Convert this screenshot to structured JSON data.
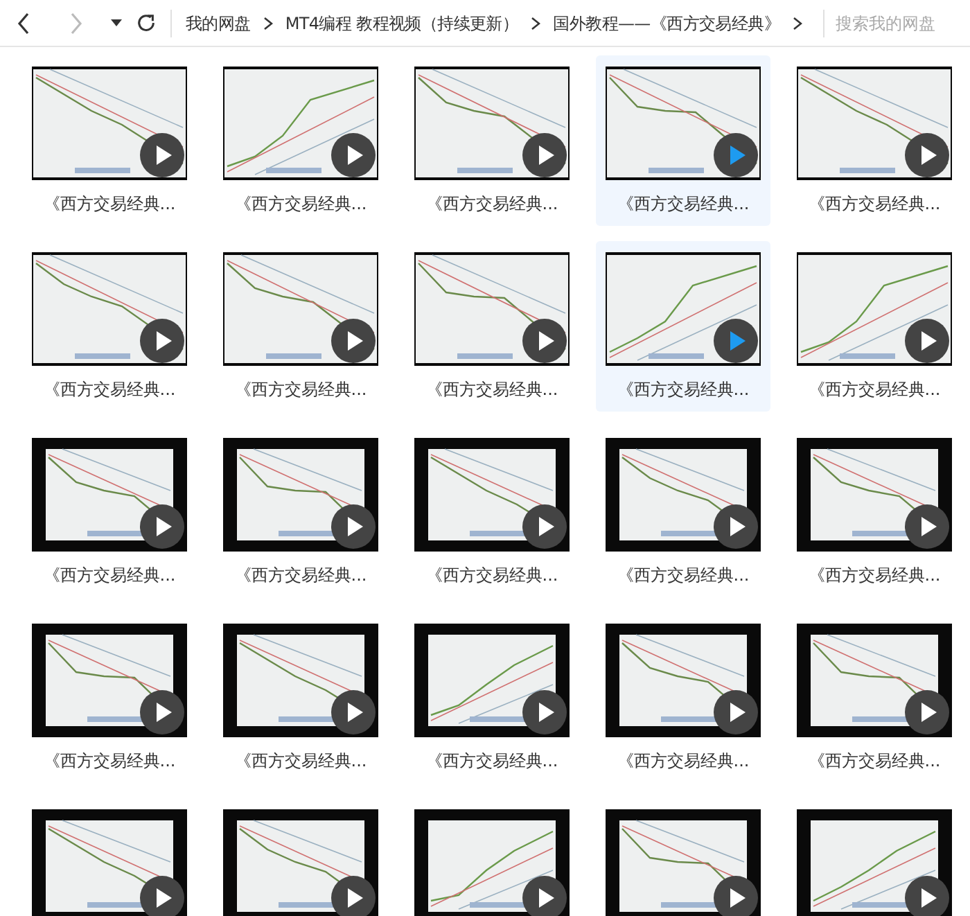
{
  "toolbar": {
    "breadcrumbs": [
      "我的网盘",
      "MT4编程 教程视频（持续更新）",
      "国外教程——《西方交易经典》"
    ],
    "search": {
      "placeholder": "搜索我的网盘"
    }
  },
  "items": [
    {
      "label": "《西方交易经典...",
      "selected": false
    },
    {
      "label": "《西方交易经典...",
      "selected": false
    },
    {
      "label": "《西方交易经典...",
      "selected": false
    },
    {
      "label": "《西方交易经典...",
      "selected": true
    },
    {
      "label": "《西方交易经典...",
      "selected": false
    },
    {
      "label": "《西方交易经典...",
      "selected": false
    },
    {
      "label": "《西方交易经典...",
      "selected": false
    },
    {
      "label": "《西方交易经典...",
      "selected": false
    },
    {
      "label": "《西方交易经典...",
      "selected": true
    },
    {
      "label": "《西方交易经典...",
      "selected": false
    },
    {
      "label": "《西方交易经典...",
      "selected": false
    },
    {
      "label": "《西方交易经典...",
      "selected": false
    },
    {
      "label": "《西方交易经典...",
      "selected": false
    },
    {
      "label": "《西方交易经典...",
      "selected": false
    },
    {
      "label": "《西方交易经典...",
      "selected": false
    },
    {
      "label": "《西方交易经典...",
      "selected": false
    },
    {
      "label": "《西方交易经典...",
      "selected": false
    },
    {
      "label": "《西方交易经典...",
      "selected": false
    },
    {
      "label": "《西方交易经典...",
      "selected": false
    },
    {
      "label": "《西方交易经典...",
      "selected": false
    },
    {
      "selected": false
    },
    {
      "selected": false
    },
    {
      "selected": false
    },
    {
      "selected": false
    },
    {
      "selected": false
    }
  ]
}
